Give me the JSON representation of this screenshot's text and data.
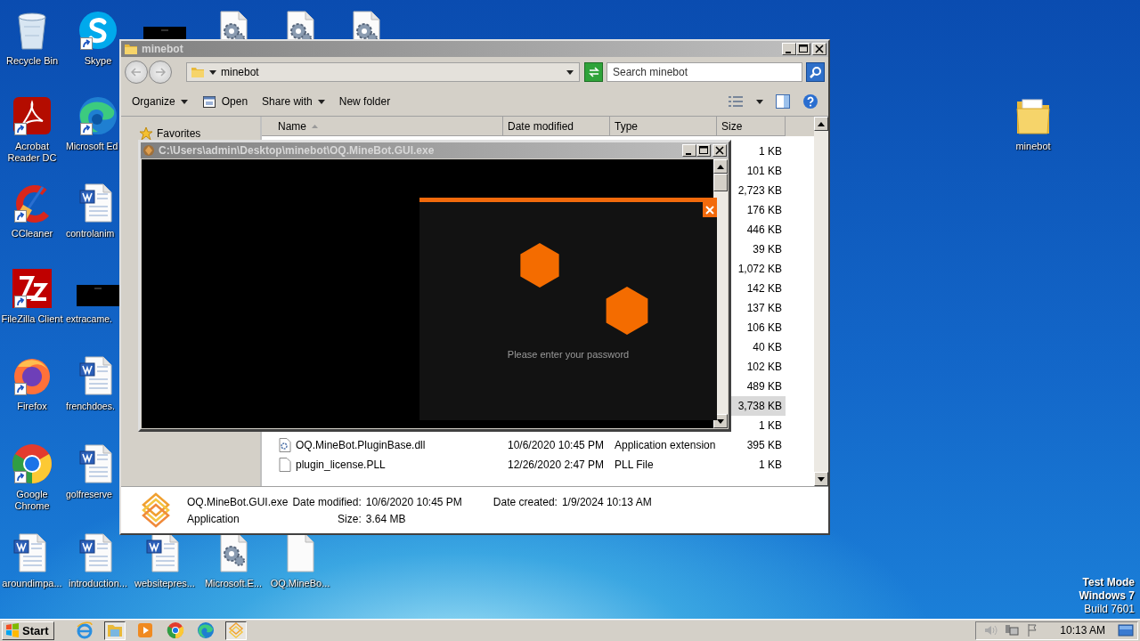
{
  "desktop": {
    "icons": [
      {
        "label": "Recycle Bin",
        "kind": "recycle-bin",
        "shortcut": false
      },
      {
        "label": "Acrobat Reader DC",
        "kind": "pdf",
        "shortcut": true
      },
      {
        "label": "CCleaner",
        "kind": "cleaner",
        "shortcut": true
      },
      {
        "label": "FileZilla Client",
        "kind": "ftp",
        "shortcut": true
      },
      {
        "label": "Firefox",
        "kind": "firefox",
        "shortcut": true
      },
      {
        "label": "Google Chrome",
        "kind": "chrome",
        "shortcut": true
      },
      {
        "label": "aroundimpa...",
        "kind": "word",
        "shortcut": false
      },
      {
        "label": "Skype",
        "kind": "chat",
        "shortcut": true
      },
      {
        "label": "Microsoft Ed",
        "kind": "edge",
        "shortcut": true
      },
      {
        "label": "controlanim",
        "kind": "word",
        "shortcut": false
      },
      {
        "label": "extracame.",
        "kind": "video",
        "shortcut": false
      },
      {
        "label": "frenchdoes.",
        "kind": "word",
        "shortcut": false
      },
      {
        "label": "golfreserve",
        "kind": "word",
        "shortcut": false
      },
      {
        "label": "introduction...",
        "kind": "word",
        "shortcut": false
      },
      {
        "kind": "video",
        "shortcut": false
      },
      {
        "label": "websitepres...",
        "kind": "word",
        "shortcut": false
      },
      {
        "kind": "settings-file",
        "shortcut": false
      },
      {
        "label": "Microsoft.E...",
        "kind": "settings-file",
        "shortcut": false
      },
      {
        "kind": "settings-file",
        "shortcut": false
      },
      {
        "label": "OQ.MineBo...",
        "kind": "blank-file",
        "shortcut": false
      },
      {
        "kind": "settings-file",
        "shortcut": false
      },
      {
        "label": "minebot",
        "kind": "folder",
        "shortcut": false
      }
    ],
    "notice": [
      "Test Mode",
      "Windows 7",
      "Build 7601"
    ]
  },
  "explorer": {
    "title": "minebot",
    "address": "minebot",
    "search": {
      "placeholder": "Search minebot"
    },
    "toolbar": [
      {
        "label": "Organize",
        "menu": true
      },
      {
        "label": "Open",
        "menu": false,
        "kind": "open"
      },
      {
        "label": "Share with",
        "menu": true
      },
      {
        "label": "New folder",
        "menu": false
      }
    ],
    "nav": {
      "items": [
        "Favorites"
      ]
    },
    "columns": [
      "Name",
      "Date modified",
      "Type",
      "Size"
    ],
    "files": [
      {
        "size": "1 KB",
        "selected": false
      },
      {
        "size": "101 KB",
        "selected": false
      },
      {
        "size": "2,723 KB",
        "selected": false
      },
      {
        "size": "176 KB",
        "selected": false
      },
      {
        "size": "446 KB",
        "selected": false
      },
      {
        "size": "39 KB",
        "selected": false
      },
      {
        "size": "1,072 KB",
        "selected": false
      },
      {
        "size": "142 KB",
        "selected": false
      },
      {
        "size": "137 KB",
        "selected": false
      },
      {
        "size": "106 KB",
        "selected": false
      },
      {
        "size": "40 KB",
        "selected": false
      },
      {
        "size": "102 KB",
        "selected": false
      },
      {
        "size": "489 KB",
        "selected": false
      },
      {
        "size": "3,738 KB",
        "selected": true
      },
      {
        "size": "1 KB",
        "selected": false
      },
      {
        "name": "OQ.MineBot.PluginBase.dll",
        "date_modified": "10/6/2020 10:45 PM",
        "type": "Application extension",
        "size": "395 KB",
        "selected": false,
        "kind": "dll"
      },
      {
        "name": "plugin_license.PLL",
        "date_modified": "12/26/2020 2:47 PM",
        "type": "PLL File",
        "size": "1 KB",
        "selected": false,
        "kind": "file"
      }
    ],
    "details": {
      "name": "OQ.MineBot.GUI.exe",
      "type": "Application",
      "properties": [
        {
          "label": "Date modified:",
          "value": "10/6/2020 10:45 PM"
        },
        {
          "label": "Size:",
          "value": "3.64 MB"
        },
        {
          "label": "Date created:",
          "value": "1/9/2024 10:13 AM"
        }
      ]
    }
  },
  "console": {
    "title": "C:\\Users\\admin\\Desktop\\minebot\\OQ.MineBot.GUI.exe",
    "dialog": {
      "message": "Please enter your password"
    }
  },
  "taskbar": {
    "start": "Start",
    "buttons": [
      {
        "kind": "ie",
        "selected": false
      },
      {
        "kind": "explorer",
        "selected": true
      },
      {
        "kind": "media",
        "selected": false
      },
      {
        "kind": "chrome",
        "selected": false
      },
      {
        "kind": "edge",
        "selected": false
      },
      {
        "kind": "app",
        "selected": true
      }
    ],
    "tray": {
      "clock": "10:13 AM"
    }
  }
}
